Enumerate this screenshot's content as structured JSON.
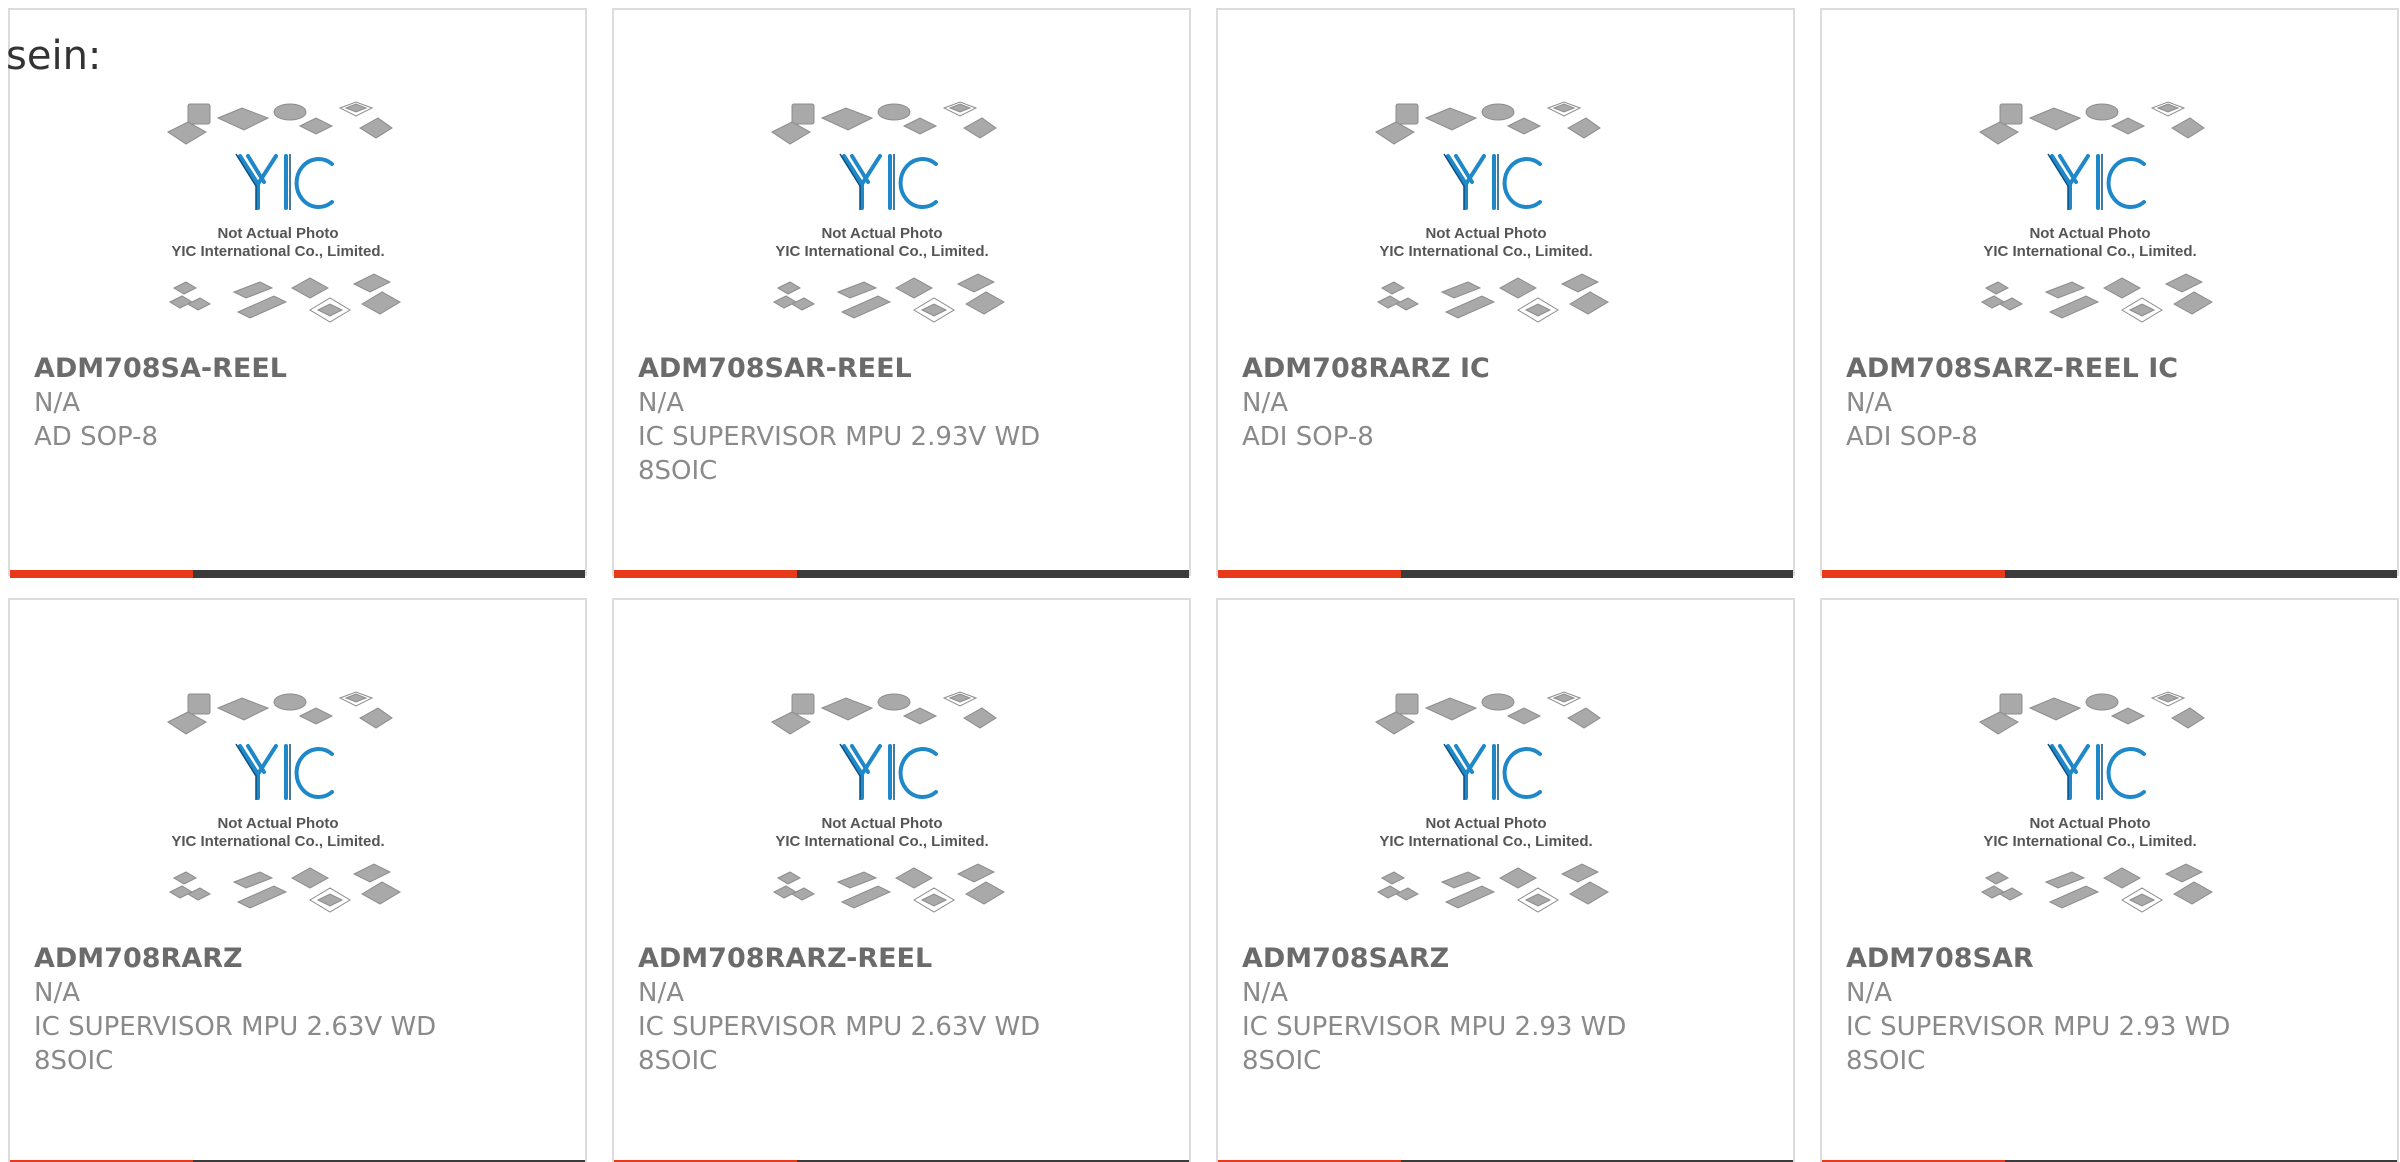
{
  "intro_text": "sein:",
  "placeholder": {
    "line1": "Not Actual Photo",
    "line2": "YIC International Co., Limited."
  },
  "colors": {
    "accent": "#e8391a",
    "bar": "#3b3b3b",
    "logo": "#1e88c8"
  },
  "products": [
    {
      "part": "ADM708SA-REEL",
      "manufacturer": "N/A",
      "description": "AD SOP-8"
    },
    {
      "part": "ADM708SAR-REEL",
      "manufacturer": "N/A",
      "description": "IC SUPERVISOR MPU 2.93V WD 8SOIC"
    },
    {
      "part": "ADM708RARZ IC",
      "manufacturer": "N/A",
      "description": "ADI SOP-8"
    },
    {
      "part": "ADM708SARZ-REEL IC",
      "manufacturer": "N/A",
      "description": "ADI SOP-8"
    },
    {
      "part": "ADM708RARZ",
      "manufacturer": "N/A",
      "description": "IC SUPERVISOR MPU 2.63V WD 8SOIC"
    },
    {
      "part": "ADM708RARZ-REEL",
      "manufacturer": "N/A",
      "description": "IC SUPERVISOR MPU 2.63V WD 8SOIC"
    },
    {
      "part": "ADM708SARZ",
      "manufacturer": "N/A",
      "description": "IC SUPERVISOR MPU 2.93 WD 8SOIC"
    },
    {
      "part": "ADM708SAR",
      "manufacturer": "N/A",
      "description": "IC SUPERVISOR MPU 2.93 WD 8SOIC"
    }
  ]
}
